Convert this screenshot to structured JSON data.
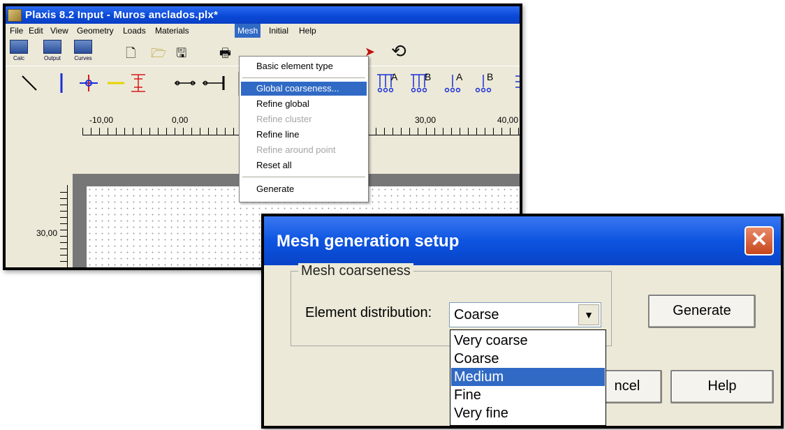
{
  "main_window": {
    "title": "Plaxis 8.2 Input - Muros anclados.plx*",
    "menu": [
      "File",
      "Edit",
      "View",
      "Geometry",
      "Loads",
      "Materials",
      "Mesh",
      "Initial",
      "Help"
    ],
    "active_menu": "Mesh",
    "toolbar": {
      "calc": "Calc",
      "output": "Output",
      "curves": "Curves"
    },
    "ruler": {
      "labels": [
        "-10,00",
        "0,00",
        "30,00",
        "40,00"
      ],
      "vertical_label": "30,00"
    }
  },
  "mesh_menu": {
    "items": [
      {
        "label": "Basic element type",
        "state": "normal"
      },
      {
        "label": "Global coarseness...",
        "state": "highlighted"
      },
      {
        "label": "Refine global",
        "state": "normal"
      },
      {
        "label": "Refine cluster",
        "state": "disabled"
      },
      {
        "label": "Refine line",
        "state": "normal"
      },
      {
        "label": "Refine around point",
        "state": "disabled"
      },
      {
        "label": "Reset all",
        "state": "normal"
      },
      {
        "label": "Generate",
        "state": "normal"
      }
    ]
  },
  "dialog": {
    "title": "Mesh generation setup",
    "group_label": "Mesh coarseness",
    "field_label": "Element distribution:",
    "selected_value": "Coarse",
    "options": [
      "Very coarse",
      "Coarse",
      "Medium",
      "Fine",
      "Very fine"
    ],
    "highlighted_option": "Medium",
    "buttons": {
      "generate": "Generate",
      "cancel": "ncel",
      "help": "Help"
    }
  }
}
